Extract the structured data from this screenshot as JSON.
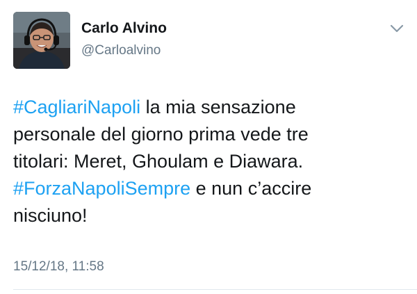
{
  "author": {
    "name": "Carlo Alvino",
    "handle": "@Carloalvino",
    "avatar": "profile-photo-with-headset"
  },
  "menu": {
    "icon": "chevron-down-icon"
  },
  "tweet": {
    "lines": [
      [
        {
          "text": "#CagliariNapoli",
          "type": "hashtag"
        },
        {
          "text": " la mia sensazione",
          "type": "text"
        }
      ],
      [
        {
          "text": "personale del giorno prima vede tre",
          "type": "text"
        }
      ],
      [
        {
          "text": "titolari: Meret, Ghoulam e Diawara.",
          "type": "text"
        }
      ],
      [
        {
          "text": "#ForzaNapoliSempre",
          "type": "hashtag"
        },
        {
          "text": " e nun c’accire",
          "type": "text"
        }
      ],
      [
        {
          "text": "nisciuno!",
          "type": "text"
        }
      ]
    ],
    "timestamp": "15/12/18, 11:58"
  },
  "colors": {
    "hashtag": "#1da1f2",
    "text": "#14171a",
    "secondary": "#657786",
    "divider": "#e1e8ed"
  }
}
